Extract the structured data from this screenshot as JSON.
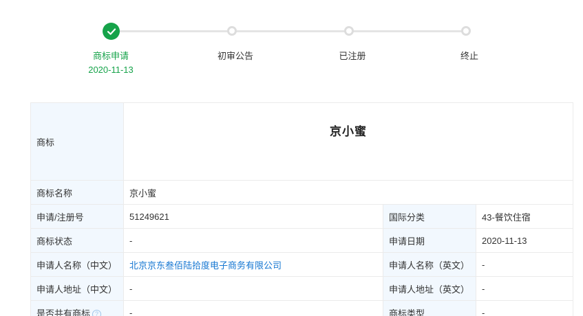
{
  "steps": [
    {
      "label": "商标申请",
      "date": "2020-11-13",
      "state": "done"
    },
    {
      "label": "初审公告",
      "date": "",
      "state": "todo"
    },
    {
      "label": "已注册",
      "date": "",
      "state": "todo"
    },
    {
      "label": "终止",
      "date": "",
      "state": "todo"
    }
  ],
  "colors": {
    "success": "#16a34a",
    "link": "#1677d2",
    "label_bg": "#f2f8fe",
    "border": "#ebebeb"
  },
  "icons": {
    "done_step": "check-icon",
    "help": "question-circle-icon"
  },
  "table": {
    "mark_label": "商标",
    "mark_image_text": "京小蜜",
    "name_label": "商标名称",
    "name_value": "京小蜜",
    "regno_label": "申请/注册号",
    "regno_value": "51249621",
    "class_label": "国际分类",
    "class_value": "43-餐饮住宿",
    "status_label": "商标状态",
    "status_value": "-",
    "appdate_label": "申请日期",
    "appdate_value": "2020-11-13",
    "applicant_cn_label": "申请人名称（中文）",
    "applicant_cn_value": "北京京东叁佰陆拾度电子商务有限公司",
    "applicant_en_label": "申请人名称（英文）",
    "applicant_en_value": "-",
    "address_cn_label": "申请人地址（中文）",
    "address_cn_value": "-",
    "address_en_label": "申请人地址（英文）",
    "address_en_value": "-",
    "shared_label": "是否共有商标",
    "shared_help": "?",
    "shared_value": "-",
    "type_label": "商标类型",
    "type_value": "-"
  }
}
